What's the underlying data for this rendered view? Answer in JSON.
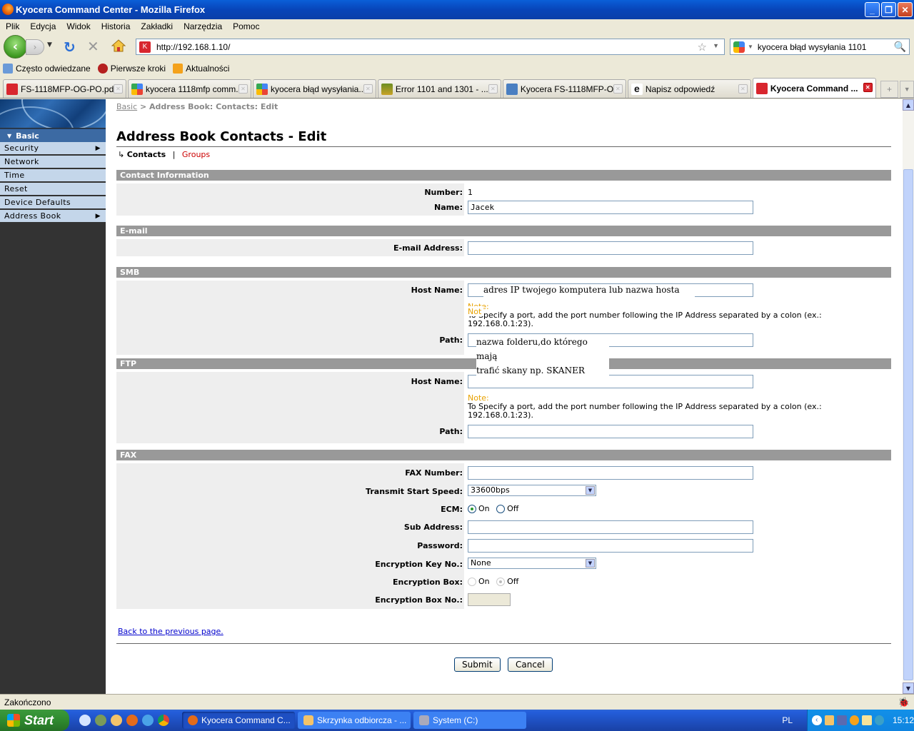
{
  "window": {
    "title": "Kyocera Command Center - Mozilla Firefox",
    "buttons": [
      "minimize",
      "restore",
      "close"
    ]
  },
  "menu": [
    "Plik",
    "Edycja",
    "Widok",
    "Historia",
    "Zakładki",
    "Narzędzia",
    "Pomoc"
  ],
  "nav": {
    "url": "http://192.168.1.10/",
    "search_value": "kyocera błąd wysyłania 1101"
  },
  "bookmarks": [
    "Często odwiedzane",
    "Pierwsze kroki",
    "Aktualności"
  ],
  "tabs": [
    {
      "label": "FS-1118MFP-OG-PO.pd...",
      "icon": "kyocera-icon",
      "active": false
    },
    {
      "label": "kyocera 1118mfp comm...",
      "icon": "google-icon",
      "active": false
    },
    {
      "label": "kyocera błąd wysyłania...",
      "icon": "google-icon",
      "active": false
    },
    {
      "label": "Error 1101 and 1301 - ...",
      "icon": "shield-icon",
      "active": false
    },
    {
      "label": "Kyocera FS-1118MFP-O...",
      "icon": "document-icon",
      "active": false
    },
    {
      "label": "Napisz odpowiedź",
      "icon": "ie-icon",
      "active": false
    },
    {
      "label": "Kyocera Command ...",
      "icon": "kyocera-icon",
      "active": true
    }
  ],
  "sidebar": {
    "heading": "Basic",
    "items": [
      {
        "label": "Security",
        "submenu": true
      },
      {
        "label": "Network",
        "submenu": false
      },
      {
        "label": "Time",
        "submenu": false
      },
      {
        "label": "Reset",
        "submenu": false
      },
      {
        "label": "Device Defaults",
        "submenu": false
      },
      {
        "label": "Address Book",
        "submenu": true
      }
    ]
  },
  "breadcrumb": {
    "link": "Basic",
    "separator": ">",
    "current": "Address Book: Contacts: Edit"
  },
  "page": {
    "title": "Address Book Contacts - Edit",
    "subnav": {
      "current": "Contacts",
      "separator": "|",
      "other": "Groups"
    }
  },
  "sections": {
    "contact": {
      "title": "Contact Information",
      "number_label": "Number:",
      "number_value": "1",
      "name_label": "Name:",
      "name_value": "Jacek"
    },
    "email": {
      "title": "E-mail",
      "address_label": "E-mail Address:",
      "address_value": ""
    },
    "smb": {
      "title": "SMB",
      "host_label": "Host Name:",
      "host_value": "",
      "note_title": "Note:",
      "note_text": "To Specify a port, add the port number following the IP Address separated by a colon (ex.: 192.168.0.1:23).",
      "path_label": "Path:",
      "path_value": ""
    },
    "ftp": {
      "title": "FTP",
      "host_label": "Host Name:",
      "host_value": "",
      "note_title": "Note:",
      "note_text": "To Specify a port, add the port number following the IP Address separated by a colon (ex.: 192.168.0.1:23).",
      "path_label": "Path:",
      "path_value": ""
    },
    "fax": {
      "title": "FAX",
      "number_label": "FAX Number:",
      "number_value": "",
      "speed_label": "Transmit Start Speed:",
      "speed_value": "33600bps",
      "ecm_label": "ECM:",
      "ecm_on": "On",
      "ecm_off": "Off",
      "ecm_selected": "On",
      "sub_label": "Sub Address:",
      "sub_value": "",
      "password_label": "Password:",
      "password_value": "",
      "key_label": "Encryption Key No.:",
      "key_value": "None",
      "box_label": "Encryption Box:",
      "box_on": "On",
      "box_off": "Off",
      "box_selected": "Off",
      "box_no_label": "Encryption Box No.:",
      "box_no_value": ""
    }
  },
  "annotations": {
    "host": "adres IP twojego komputera lub nazwa hosta",
    "path_line1": "nazwa folderu,do którego mają",
    "path_line2": "trafić skany np.  SKANER"
  },
  "footer": {
    "back_link": "Back to the previous page.",
    "submit": "Submit",
    "cancel": "Cancel"
  },
  "status": "Zakończono",
  "taskbar": {
    "start": "Start",
    "tasks": [
      {
        "label": "Kyocera Command C...",
        "active": true
      },
      {
        "label": "Skrzynka odbiorcza - ...",
        "active": false
      },
      {
        "label": "System (C:)",
        "active": false
      }
    ],
    "language": "PL",
    "clock": "15:12"
  }
}
